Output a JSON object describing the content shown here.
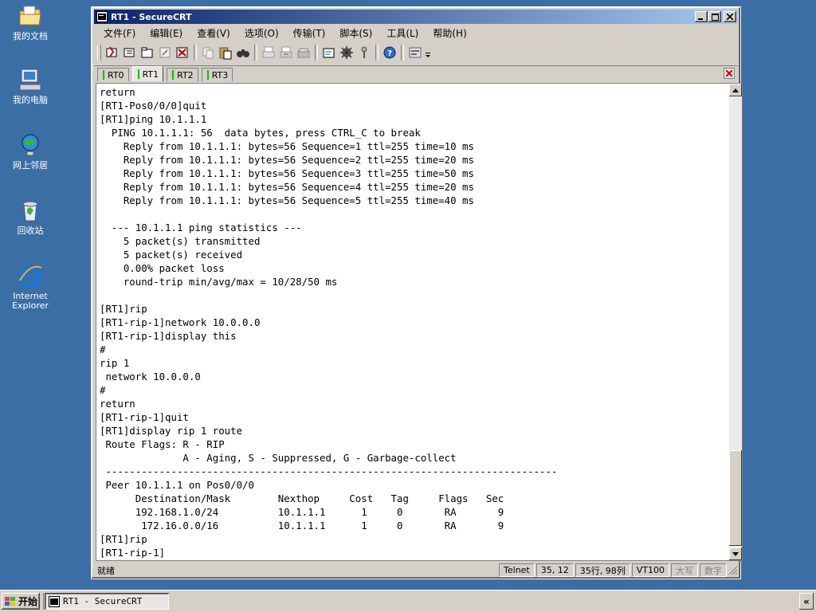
{
  "desktop": {
    "icons": [
      {
        "label": "我的文档",
        "icon": "my-documents-icon"
      },
      {
        "label": "我的电脑",
        "icon": "my-computer-icon"
      },
      {
        "label": "网上邻居",
        "icon": "network-places-icon"
      },
      {
        "label": "回收站",
        "icon": "recycle-bin-icon"
      },
      {
        "label": "Internet Explorer",
        "icon": "internet-explorer-icon"
      }
    ]
  },
  "window": {
    "title": "RT1 - SecureCRT",
    "menu": [
      "文件(F)",
      "编辑(E)",
      "查看(V)",
      "选项(O)",
      "传输(T)",
      "脚本(S)",
      "工具(L)",
      "帮助(H)"
    ],
    "tabs": [
      {
        "label": "RT0",
        "active": false
      },
      {
        "label": "RT1",
        "active": true
      },
      {
        "label": "RT2",
        "active": false
      },
      {
        "label": "RT3",
        "active": false
      }
    ],
    "terminal_lines": [
      "return",
      "[RT1-Pos0/0/0]quit",
      "[RT1]ping 10.1.1.1",
      "  PING 10.1.1.1: 56  data bytes, press CTRL_C to break",
      "    Reply from 10.1.1.1: bytes=56 Sequence=1 ttl=255 time=10 ms",
      "    Reply from 10.1.1.1: bytes=56 Sequence=2 ttl=255 time=20 ms",
      "    Reply from 10.1.1.1: bytes=56 Sequence=3 ttl=255 time=50 ms",
      "    Reply from 10.1.1.1: bytes=56 Sequence=4 ttl=255 time=20 ms",
      "    Reply from 10.1.1.1: bytes=56 Sequence=5 ttl=255 time=40 ms",
      "",
      "  --- 10.1.1.1 ping statistics ---",
      "    5 packet(s) transmitted",
      "    5 packet(s) received",
      "    0.00% packet loss",
      "    round-trip min/avg/max = 10/28/50 ms",
      "",
      "[RT1]rip",
      "[RT1-rip-1]network 10.0.0.0",
      "[RT1-rip-1]display this",
      "#",
      "rip 1",
      " network 10.0.0.0",
      "#",
      "return",
      "[RT1-rip-1]quit",
      "[RT1]display rip 1 route",
      " Route Flags: R - RIP",
      "              A - Aging, S - Suppressed, G - Garbage-collect",
      " ----------------------------------------------------------------------------",
      " Peer 10.1.1.1 on Pos0/0/0",
      "      Destination/Mask        Nexthop     Cost   Tag     Flags   Sec",
      "      192.168.1.0/24          10.1.1.1      1     0       RA       9",
      "       172.16.0.0/16          10.1.1.1      1     0       RA       9",
      "[RT1]rip",
      "[RT1-rip-1]"
    ],
    "status": {
      "ready": "就绪",
      "protocol": "Telnet",
      "cursor": "35,  12",
      "size": "35行, 98列",
      "emulation": "VT100",
      "caps": "大写",
      "num": "数字"
    }
  },
  "taskbar": {
    "start_label": "开始",
    "task_label": "RT1 - SecureCRT",
    "tray_label": "«"
  },
  "colors": {
    "desktop": "#3a6ea5",
    "titlebar_start": "#0a246a",
    "titlebar_end": "#a6caf0",
    "chrome": "#d4d0c8",
    "terminal_bg": "#ffffff",
    "tab_led": "#00c000",
    "tab_close": "#cc0000"
  }
}
